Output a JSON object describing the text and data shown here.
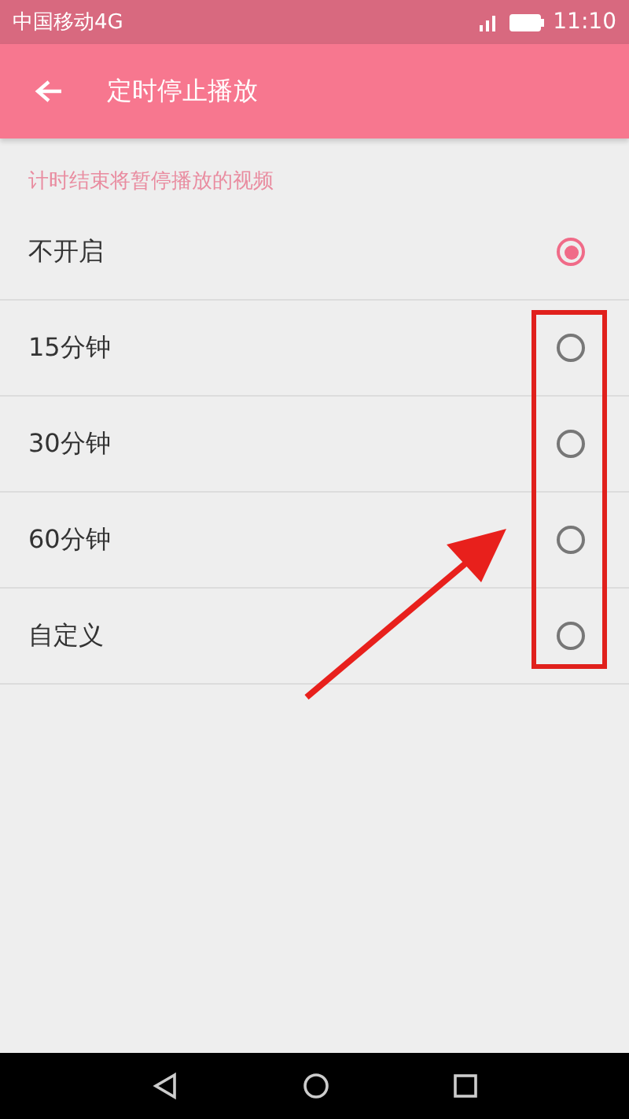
{
  "status_bar": {
    "carrier": "中国移动4G",
    "time": "11:10"
  },
  "app_bar": {
    "title": "定时停止播放"
  },
  "section": {
    "hint": "计时结束将暂停播放的视频"
  },
  "options": [
    {
      "label": "不开启",
      "selected": true
    },
    {
      "label": "15分钟",
      "selected": false
    },
    {
      "label": "30分钟",
      "selected": false
    },
    {
      "label": "60分钟",
      "selected": false
    },
    {
      "label": "自定义",
      "selected": false
    }
  ]
}
